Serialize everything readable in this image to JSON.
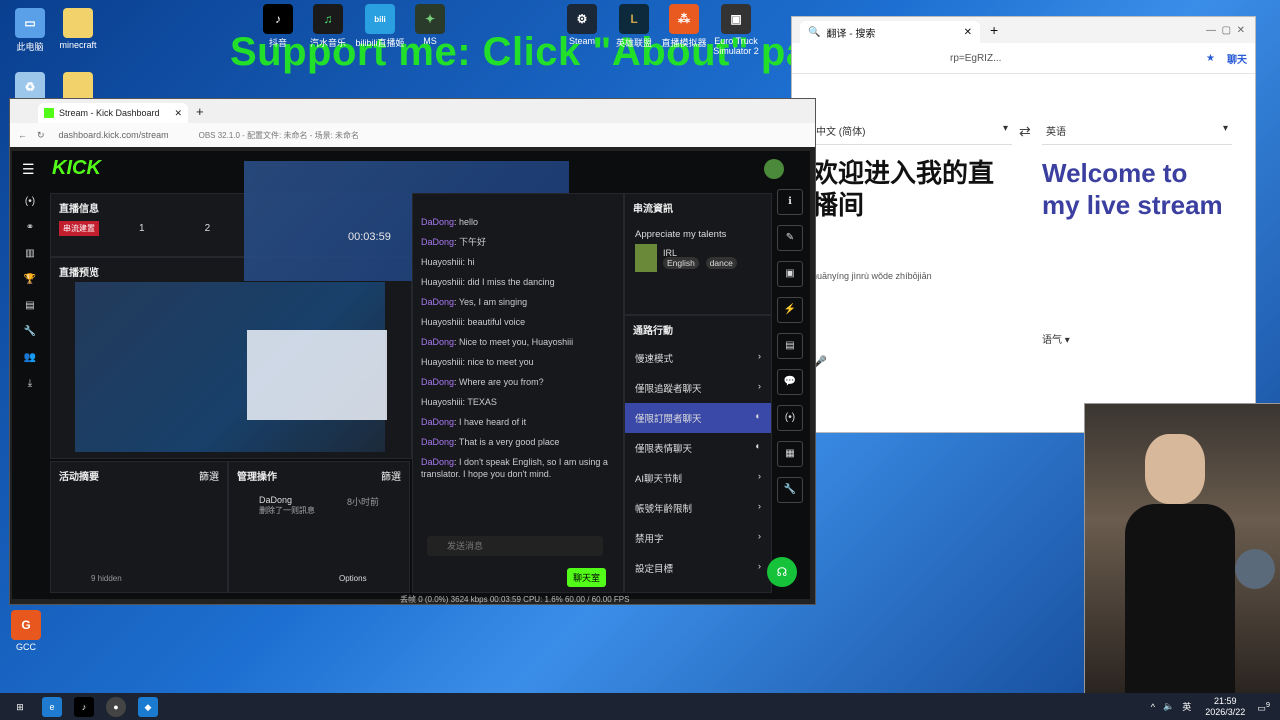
{
  "banner": "Support me: Click \"About\" panel below",
  "desktop_icons": [
    {
      "label": "此电脑",
      "icon": "computer-icon"
    },
    {
      "label": "minecraft",
      "icon": "folder-icon"
    },
    {
      "label": "抖音",
      "icon": "tiktok-icon"
    },
    {
      "label": "汽水音乐",
      "icon": "music-icon"
    },
    {
      "label": "bilibili直播姬",
      "icon": "bilibili-icon"
    },
    {
      "label": "MS",
      "icon": "ms-icon"
    },
    {
      "label": "Steam",
      "icon": "steam-icon"
    },
    {
      "label": "英雄联盟",
      "icon": "lol-icon"
    },
    {
      "label": "直播模拟器",
      "icon": "network-icon"
    },
    {
      "label": "Euro Truck Simulator 2",
      "icon": "truck-icon"
    },
    {
      "label": "GCC",
      "icon": "gcc-icon"
    }
  ],
  "translate": {
    "tab_title": "翻译 - 搜索",
    "address": "rp=EgRIZ...",
    "source_lang": "中文 (简体)",
    "target_lang": "英语",
    "source_text": "欢迎进入我的直播间",
    "pinyin": "huānyíng jìnrù wǒde zhíbōjiān",
    "target_text": "Welcome to my live stream",
    "tone_label": "语气",
    "chat_button": "聊天"
  },
  "kick": {
    "tab_title": "Stream - Kick Dashboard",
    "address": "dashboard.kick.com/stream",
    "obs_title": "OBS 32.1.0 - 配置文件: 未命名 - 场景: 未命名",
    "logo": "KICK",
    "stream_info": {
      "title": "直播信息",
      "badge": "串流建置",
      "stat1": "1",
      "stat2": "2"
    },
    "preview_title": "直播预览",
    "activity_title": "活动摘要",
    "manage_title": "管理操作",
    "filter": "篩選",
    "manage_user": "DaDong",
    "manage_time": "8小时前",
    "manage_action": "删除了一则訊息",
    "hidden_count": "9 hidden",
    "options": "Options",
    "chat_title": "聊天室",
    "chat": [
      {
        "user": "DaDong",
        "text": "hello"
      },
      {
        "user": "DaDong",
        "text": "下午好"
      },
      {
        "user": "Huayoshiii",
        "text": "hi"
      },
      {
        "user": "Huayoshiii",
        "text": "did I miss the dancing"
      },
      {
        "user": "DaDong",
        "text": "Yes, I am singing"
      },
      {
        "user": "Huayoshiii",
        "text": "beautiful voice"
      },
      {
        "user": "DaDong",
        "text": "Nice to meet you, Huayoshiii"
      },
      {
        "user": "Huayoshiii",
        "text": "nice to meet you"
      },
      {
        "user": "DaDong",
        "text": "Where are you from?"
      },
      {
        "user": "Huayoshiii",
        "text": "TEXAS"
      },
      {
        "user": "DaDong",
        "text": "I have heard of it"
      },
      {
        "user": "DaDong",
        "text": "That is a very good place"
      },
      {
        "user": "DaDong",
        "text": "I don't speak English, so I am using a translator. I hope you don't mind."
      }
    ],
    "chat_placeholder": "发送消息",
    "chat_send": "聊天室",
    "stream_panel_title": "串流資訊",
    "appreciate": "Appreciate my talents",
    "category": "IRL",
    "tags": [
      "English",
      "dance"
    ],
    "actions_title": "通路行動",
    "actions": [
      {
        "label": "慢速模式",
        "toggle": false
      },
      {
        "label": "僅限追蹤者聊天",
        "toggle": false
      },
      {
        "label": "僅限訂閱者聊天",
        "toggle": true
      },
      {
        "label": "僅限表情聊天",
        "toggle": true
      },
      {
        "label": "AI聊天节制",
        "toggle": false
      },
      {
        "label": "帳號年齡限制",
        "toggle": false
      },
      {
        "label": "禁用字",
        "toggle": false
      },
      {
        "label": "設定目標",
        "toggle": false
      }
    ],
    "obs_status": "丢帧 0 (0.0%)   3624 kbps   00:03:59   CPU: 1.6%   60.00 / 60.00 FPS",
    "timer": "00:03:59"
  },
  "taskbar": {
    "time": "21:59",
    "date": "2026/3/22",
    "lang": "英",
    "notif": "9"
  }
}
